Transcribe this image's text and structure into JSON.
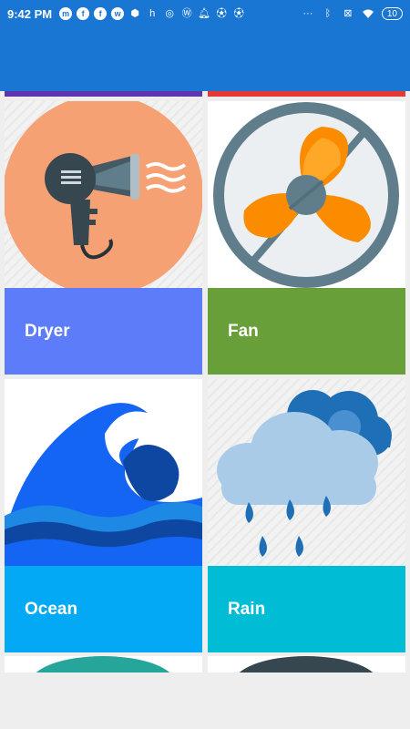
{
  "status_bar": {
    "time": "9:42 PM",
    "battery": "10",
    "notification_icons": [
      "messenger-icon",
      "facebook-icon",
      "facebook-icon",
      "whatsapp-icon",
      "box-icon",
      "h-icon",
      "instagram-icon",
      "wordpress-icon",
      "bell-icon",
      "soccer-ball-icon",
      "soccer-ball-icon"
    ],
    "system_icons": [
      "more-dots-icon",
      "bluetooth-icon",
      "no-sim-icon",
      "wifi-icon",
      "battery-icon"
    ]
  },
  "app_bar": {
    "color": "#1976d2"
  },
  "cards": [
    {
      "label": "Dryer",
      "label_color": "#5c7cfa",
      "icon": "hair-dryer-icon"
    },
    {
      "label": "Fan",
      "label_color": "#689f38",
      "icon": "fan-icon"
    },
    {
      "label": "Ocean",
      "label_color": "#03a9f4",
      "icon": "ocean-wave-icon"
    },
    {
      "label": "Rain",
      "label_color": "#00bcd4",
      "icon": "rain-cloud-icon"
    }
  ],
  "previous_row_colors": [
    "#5e35b1",
    "#e53935"
  ]
}
